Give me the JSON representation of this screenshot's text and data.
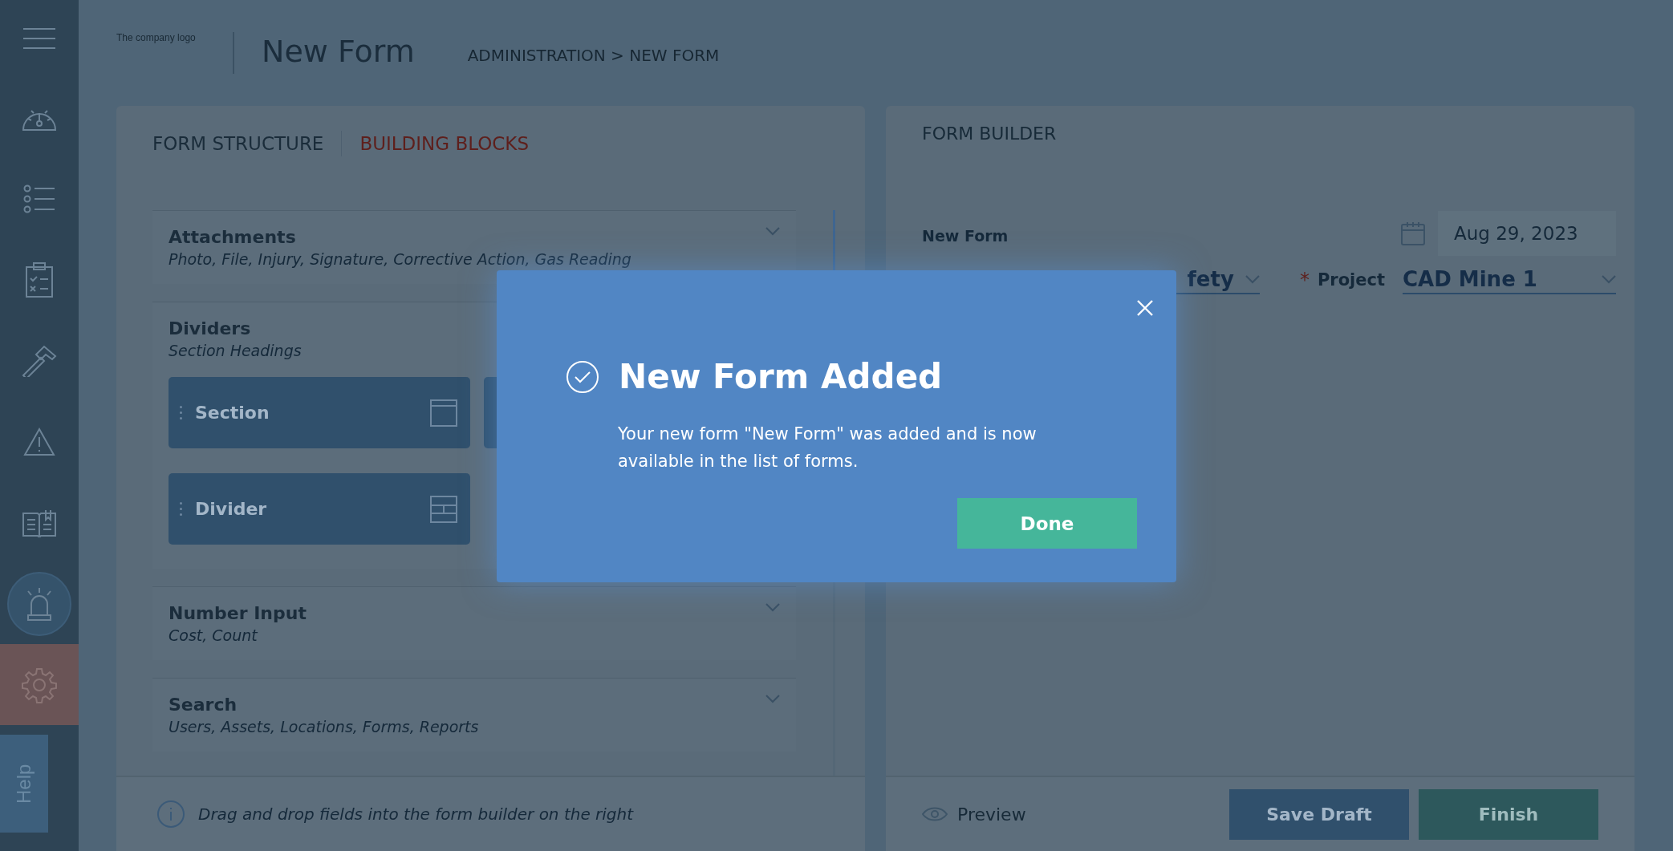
{
  "sidebar": {
    "items": [
      {
        "kind": "menu",
        "selected": false
      },
      {
        "kind": "dashboard",
        "selected": false
      },
      {
        "kind": "list",
        "selected": false
      },
      {
        "kind": "clipboard",
        "selected": false
      },
      {
        "kind": "hammer",
        "selected": false
      },
      {
        "kind": "warning",
        "selected": false
      },
      {
        "kind": "book",
        "selected": false
      },
      {
        "kind": "alarm",
        "selected": false
      },
      {
        "kind": "settings",
        "selected": true
      }
    ],
    "help": "Help"
  },
  "header": {
    "logo_alt": "The company logo",
    "title": "New Form",
    "breadcrumb": "ADMINISTRATION > NEW FORM"
  },
  "left_panel": {
    "tabs": [
      {
        "label": "FORM STRUCTURE",
        "selected": false
      },
      {
        "label": "BUILDING BLOCKS",
        "selected": true
      }
    ],
    "groups": [
      {
        "title": "Attachments",
        "subtitle": "Photo, File, Injury, Signature, Corrective Action, Gas Reading",
        "expanded": false
      },
      {
        "title": "Dividers",
        "subtitle": "Section Headings",
        "expanded": true,
        "blocks": [
          {
            "kind": "section",
            "label": "Section"
          },
          {
            "kind": "tile"
          },
          {
            "kind": "divider",
            "label": "Divider"
          }
        ]
      },
      {
        "title": "Number Input",
        "subtitle": "Cost, Count",
        "expanded": false
      },
      {
        "title": "Search",
        "subtitle": "Users, Assets, Locations, Forms, Reports",
        "expanded": false
      }
    ],
    "hint": "Drag and drop fields into the form builder on the right"
  },
  "right_panel": {
    "title": "FORM BUILDER",
    "form_name": "New Form",
    "date": "Aug 29, 2023",
    "category": "fety",
    "project": {
      "required_mark": "*",
      "label": "Project",
      "value": "CAD Mine 1"
    },
    "preview": "Preview",
    "buttons": [
      {
        "kind": "secondary",
        "label": "Save Draft"
      },
      {
        "kind": "primary",
        "label": "Finish"
      }
    ]
  },
  "dialog": {
    "title": "New Form Added",
    "message": "Your new form \"New Form\" was added and is now available in the list of forms.",
    "button": "Done"
  }
}
